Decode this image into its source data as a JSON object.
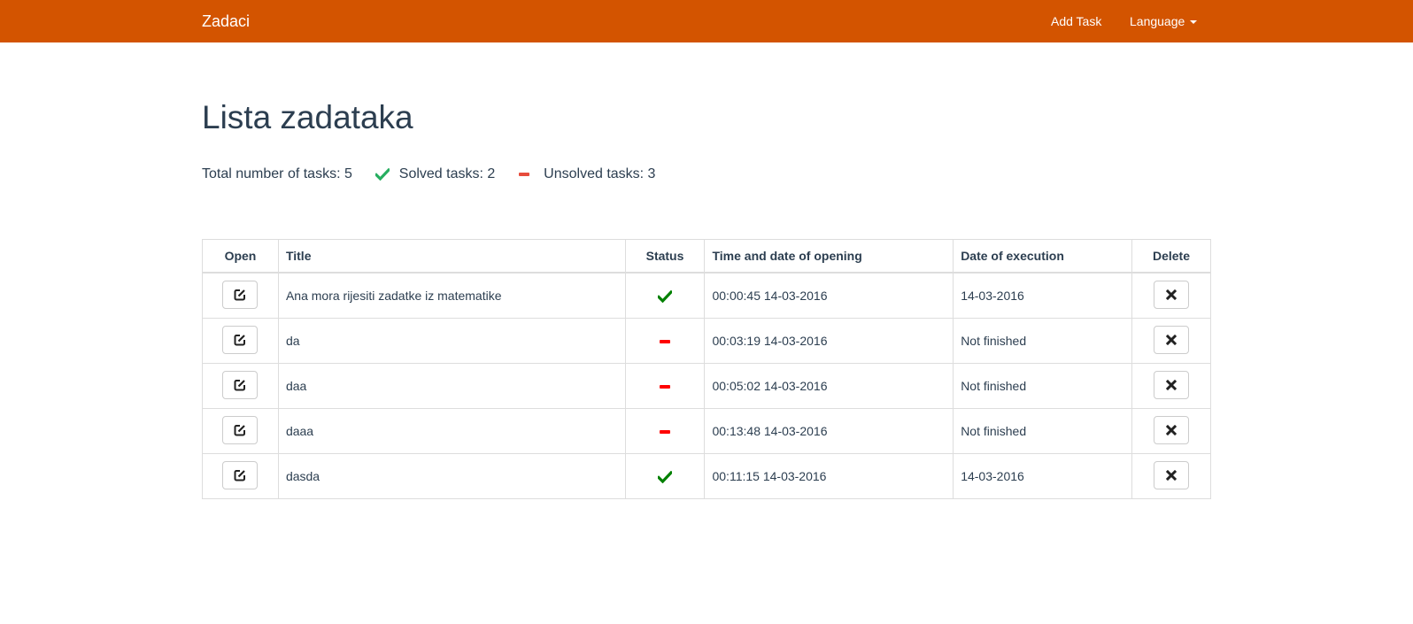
{
  "navbar": {
    "brand": "Zadaci",
    "add_task": "Add Task",
    "language": "Language",
    "background": "#d35400"
  },
  "page": {
    "title": "Lista zadataka"
  },
  "summary": {
    "total_label": "Total number of tasks: 5",
    "solved_label": "Solved tasks: 2",
    "unsolved_label": "Unsolved tasks: 3",
    "solved_icon": "check-icon",
    "unsolved_icon": "minus-icon",
    "solved_color": "#27ae60",
    "unsolved_color": "#e74c3c"
  },
  "table": {
    "headers": {
      "open": "Open",
      "title": "Title",
      "status": "Status",
      "opened": "Time and date of opening",
      "executed": "Date of execution",
      "delete": "Delete"
    },
    "rows": [
      {
        "title": "Ana mora rijesiti zadatke iz matematike",
        "status": "solved",
        "opened": "00:00:45 14-03-2016",
        "executed": "14-03-2016"
      },
      {
        "title": "da",
        "status": "unsolved",
        "opened": "00:03:19 14-03-2016",
        "executed": "Not finished"
      },
      {
        "title": "daa",
        "status": "unsolved",
        "opened": "00:05:02 14-03-2016",
        "executed": "Not finished"
      },
      {
        "title": "daaa",
        "status": "unsolved",
        "opened": "00:13:48 14-03-2016",
        "executed": "Not finished"
      },
      {
        "title": "dasda",
        "status": "solved",
        "opened": "00:11:15 14-03-2016",
        "executed": "14-03-2016"
      }
    ],
    "open_icon": "edit-icon",
    "delete_icon": "close-icon",
    "solved_color": "#008000",
    "unsolved_color": "#ff0000"
  }
}
